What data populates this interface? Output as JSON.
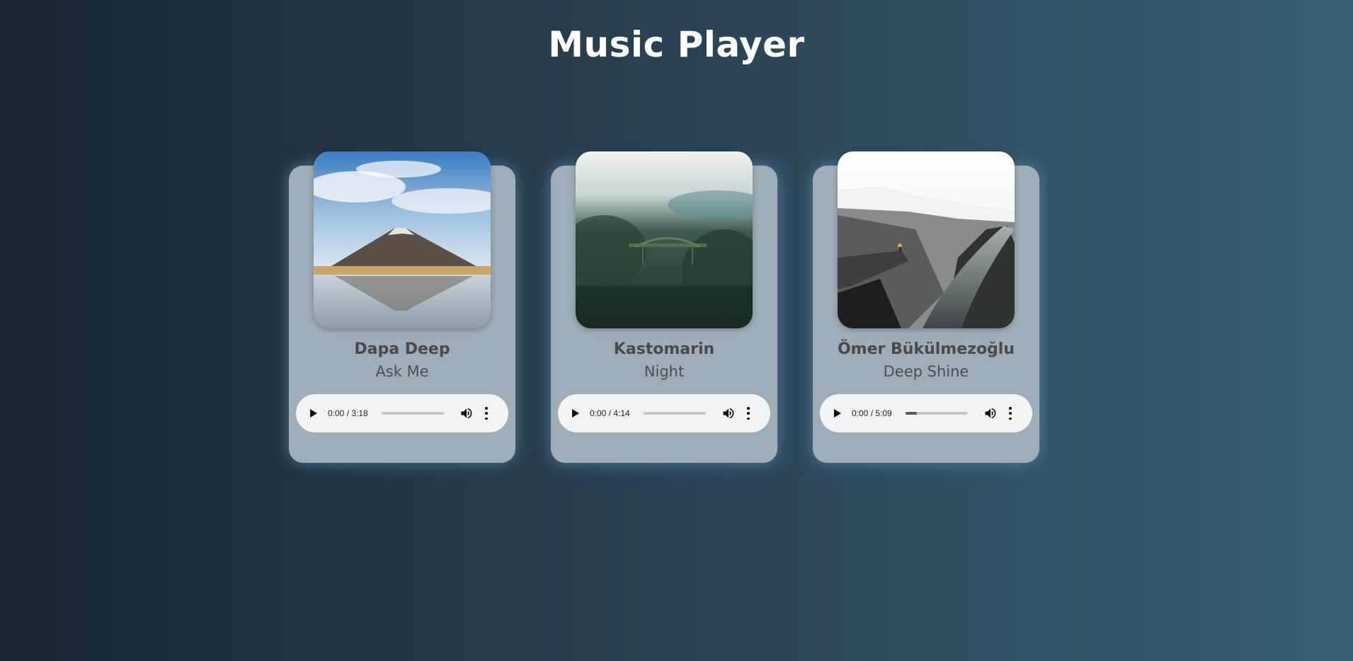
{
  "page": {
    "title": "Music Player"
  },
  "cards": [
    {
      "artist": "Dapa Deep",
      "track": "Ask Me",
      "image": "mountain-lake-reflection",
      "player": {
        "time": "0:00 / 3:18",
        "progress": 0.0,
        "play_icon": "play-icon",
        "volume_icon": "volume-icon",
        "menu_icon": "more-vert-icon"
      }
    },
    {
      "artist": "Kastomarin",
      "track": "Night",
      "image": "foggy-forest-bridge",
      "player": {
        "time": "0:00 / 4:14",
        "progress": 0.0,
        "play_icon": "play-icon",
        "volume_icon": "volume-icon",
        "menu_icon": "more-vert-icon"
      }
    },
    {
      "artist": "Ömer Bükülmezoğlu",
      "track": "Deep Shine",
      "image": "fjord-cliff",
      "player": {
        "time": "0:00 / 5:09",
        "progress": 0.18,
        "play_icon": "play-icon",
        "volume_icon": "volume-icon",
        "menu_icon": "more-vert-icon"
      }
    }
  ],
  "colors": {
    "card_bg": "#9eadb7",
    "player_bg": "#f1f3f4",
    "text_dark": "#4a4a4a",
    "title": "#ffffff"
  }
}
